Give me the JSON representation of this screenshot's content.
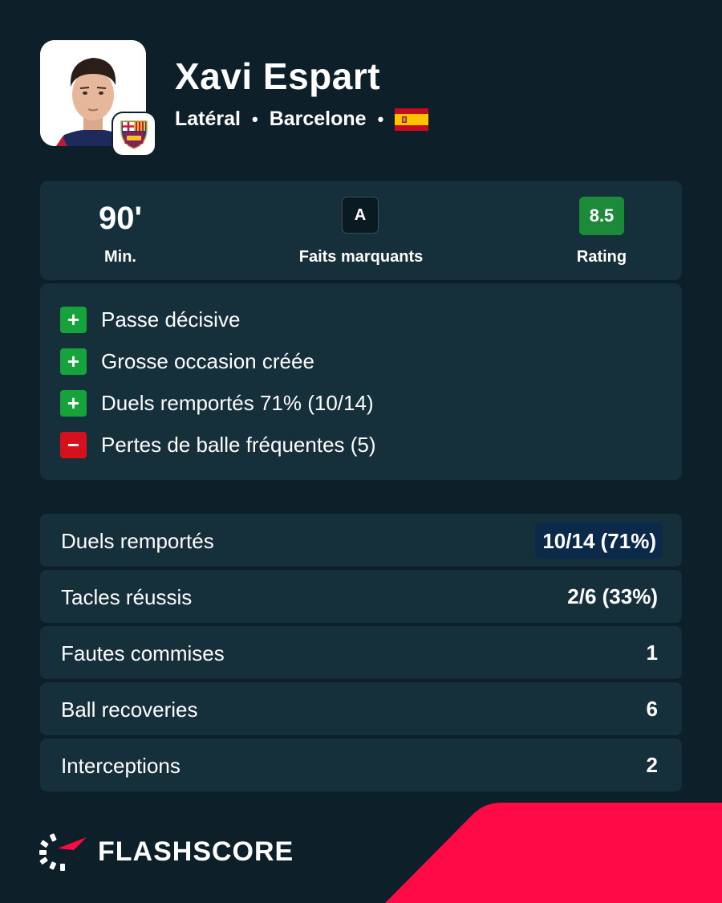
{
  "player": {
    "name": "Xavi Espart",
    "position": "Latéral",
    "club": "Barcelone",
    "separator": "•",
    "nationality_flag": "spain-flag-icon"
  },
  "summary": {
    "minutes": {
      "value": "90'",
      "label": "Min."
    },
    "highlights": {
      "badge": "A",
      "label": "Faits marquants"
    },
    "rating": {
      "value": "8.5",
      "label": "Rating",
      "color": "#1d8a3a"
    }
  },
  "highlights": [
    {
      "type": "plus",
      "sign": "+",
      "text": "Passe décisive"
    },
    {
      "type": "plus",
      "sign": "+",
      "text": "Grosse occasion créée"
    },
    {
      "type": "plus",
      "sign": "+",
      "text": "Duels remportés 71% (10/14)"
    },
    {
      "type": "minus",
      "sign": "−",
      "text": "Pertes de balle fréquentes (5)"
    }
  ],
  "stats": [
    {
      "label": "Duels remportés",
      "value": "10/14 (71%)",
      "highlighted": true
    },
    {
      "label": "Tacles réussis",
      "value": "2/6 (33%)",
      "highlighted": false
    },
    {
      "label": "Fautes commises",
      "value": "1",
      "highlighted": false
    },
    {
      "label": "Ball recoveries",
      "value": "6",
      "highlighted": false
    },
    {
      "label": "Interceptions",
      "value": "2",
      "highlighted": false
    }
  ],
  "brand": {
    "name": "FLASHSCORE",
    "logo": "flashscore-logo-icon"
  },
  "colors": {
    "background": "#0d1f28",
    "card": "#15303b",
    "positive": "#17a33c",
    "negative": "#d6111e",
    "accent": "#ff0a46"
  }
}
